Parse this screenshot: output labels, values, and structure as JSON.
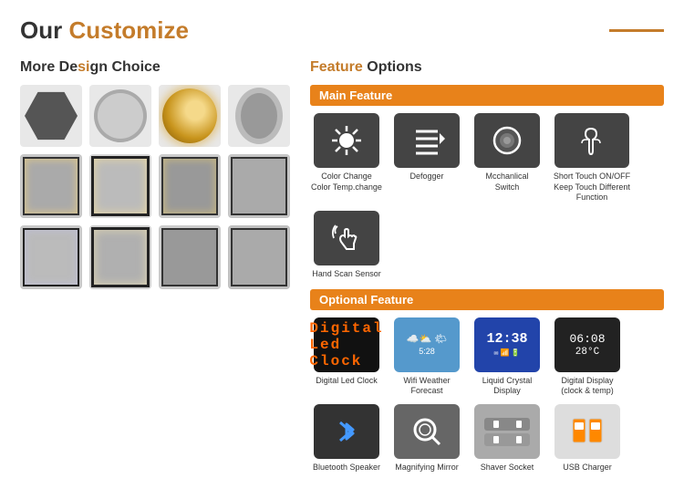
{
  "header": {
    "title_prefix": "Our ",
    "title_accent": "Customize",
    "line_visible": true
  },
  "left": {
    "section_title_normal": "More De",
    "section_title_accent": "si",
    "section_title_rest": "gn Choice",
    "design_rows": [
      [
        "hexagon",
        "round-mirror",
        "round-glow",
        "oval-mirror"
      ],
      [
        "rect-1",
        "rect-2",
        "rect-3",
        "rect-4"
      ],
      [
        "rect-5",
        "rect-6",
        "rect-7",
        "rect-8"
      ]
    ]
  },
  "right": {
    "section_title_normal": "",
    "section_title_accent": "Feature",
    "section_title_rest": " Options",
    "main_feature": {
      "header": "Main Feature",
      "items": [
        {
          "label": "Color Change\nColor Temp.change",
          "icon_type": "sun"
        },
        {
          "label": "Defogger",
          "icon_type": "defog"
        },
        {
          "label": "Mcchanlical\nSwitch",
          "icon_type": "switch"
        },
        {
          "label": "Short Touch ON/OFF\nKeep Touch Different\nFunction",
          "icon_type": "touch"
        },
        {
          "label": "Hand Scan Sensor",
          "icon_type": "hand"
        }
      ]
    },
    "optional_feature": {
      "header": "Optional Feature",
      "rows": [
        [
          {
            "label": "Digital Led Clock",
            "icon_type": "clock"
          },
          {
            "label": "Wifi Weather Forecast",
            "icon_type": "weather"
          },
          {
            "label": "Liquid Crystal Display",
            "icon_type": "lcd"
          },
          {
            "label": "Digital Display\n(clock & temp)",
            "icon_type": "digital"
          }
        ],
        [
          {
            "label": "Bluetooth Speaker",
            "icon_type": "bluetooth"
          },
          {
            "label": "Magnifying Mirror",
            "icon_type": "magnify"
          },
          {
            "label": "Shaver Socket",
            "icon_type": "shaver"
          },
          {
            "label": "USB Charger",
            "icon_type": "usb"
          }
        ]
      ]
    }
  }
}
